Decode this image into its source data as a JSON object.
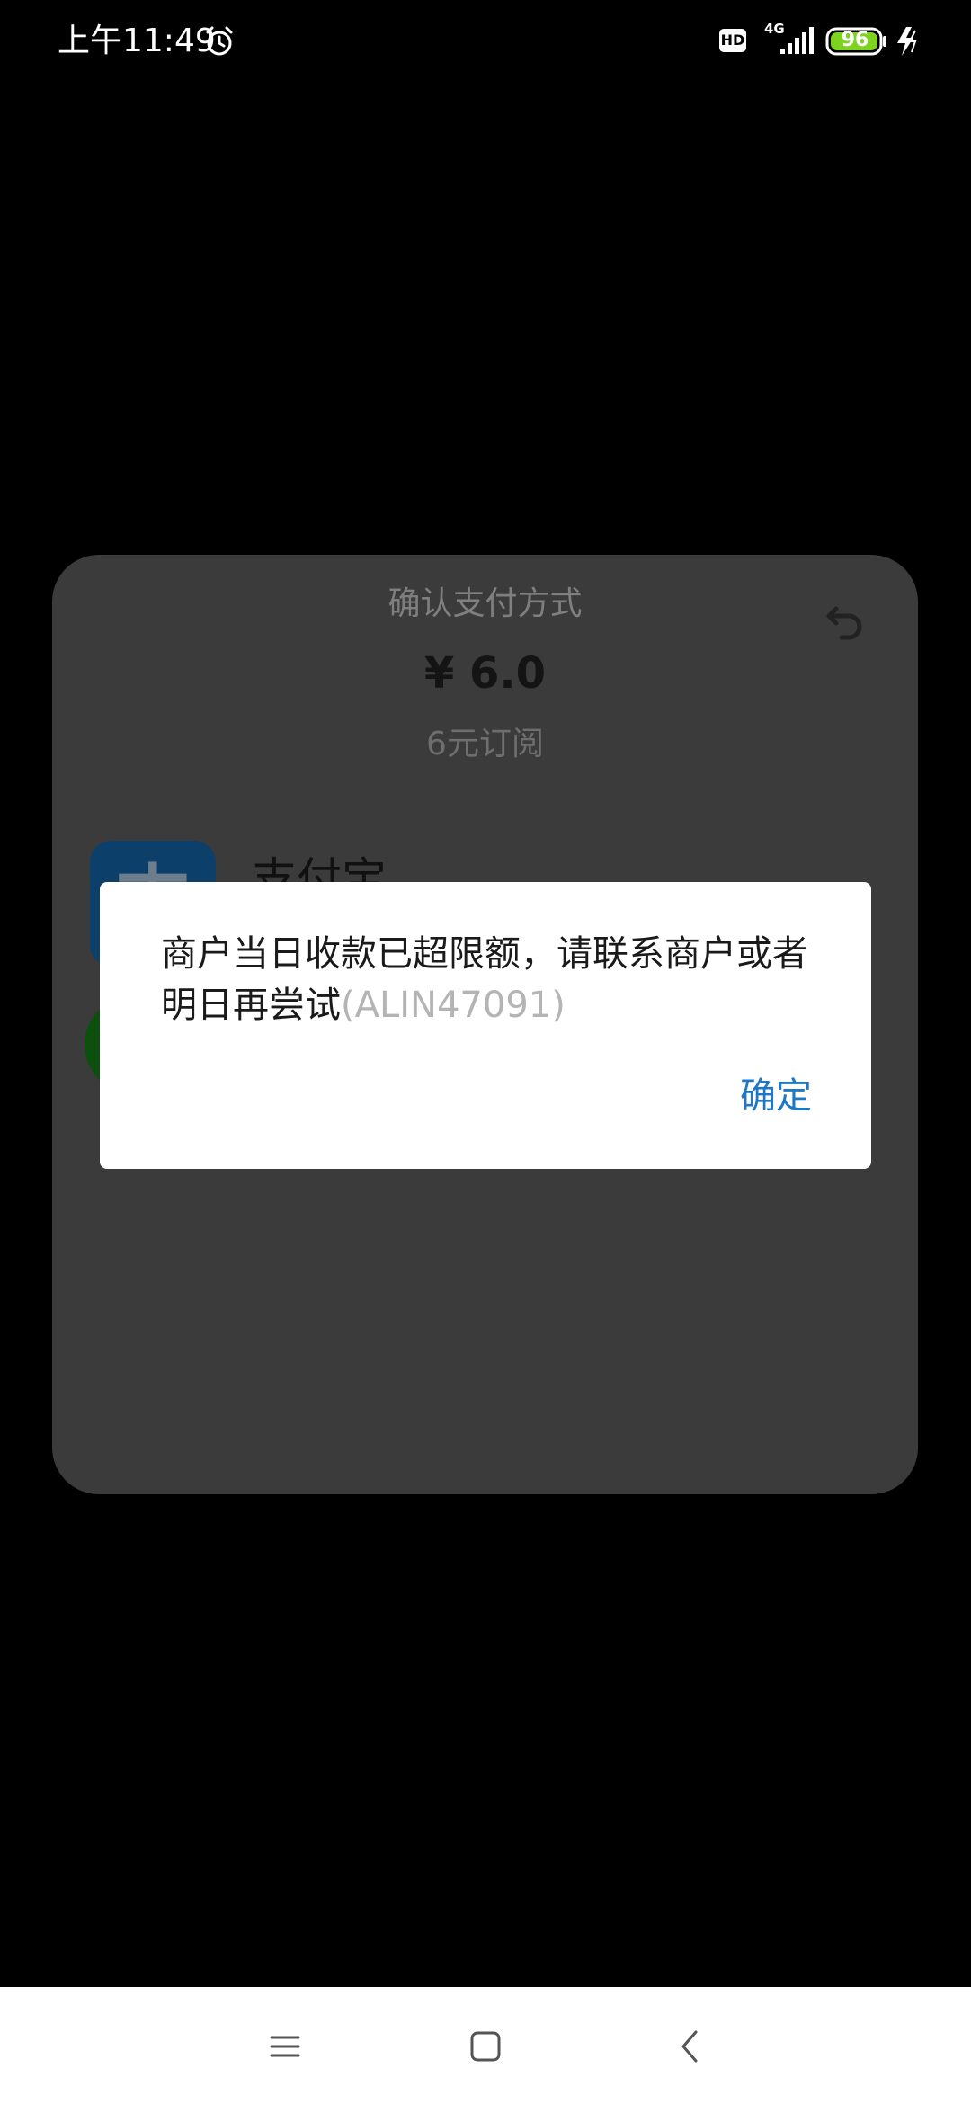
{
  "status_bar": {
    "time": "上午11:49",
    "hd_label": "HD",
    "network_label": "4G",
    "battery_level": "96",
    "battery_color": "#7ed321"
  },
  "payment_sheet": {
    "title": "确认支付方式",
    "amount": "¥ 6.0",
    "description": "6元订阅",
    "methods": [
      {
        "name": "支付宝",
        "icon": "alipay-icon"
      },
      {
        "name": "",
        "icon": "wechat-pay-icon"
      }
    ]
  },
  "dialog": {
    "message": "商户当日收款已超限额，请联系商户或者明日再尝试",
    "error_code": "(ALIN47091)",
    "confirm_label": "确定",
    "accent_color": "#1e78c8"
  },
  "nav_bar": {
    "icons": [
      "menu-icon",
      "home-icon",
      "back-icon"
    ]
  }
}
